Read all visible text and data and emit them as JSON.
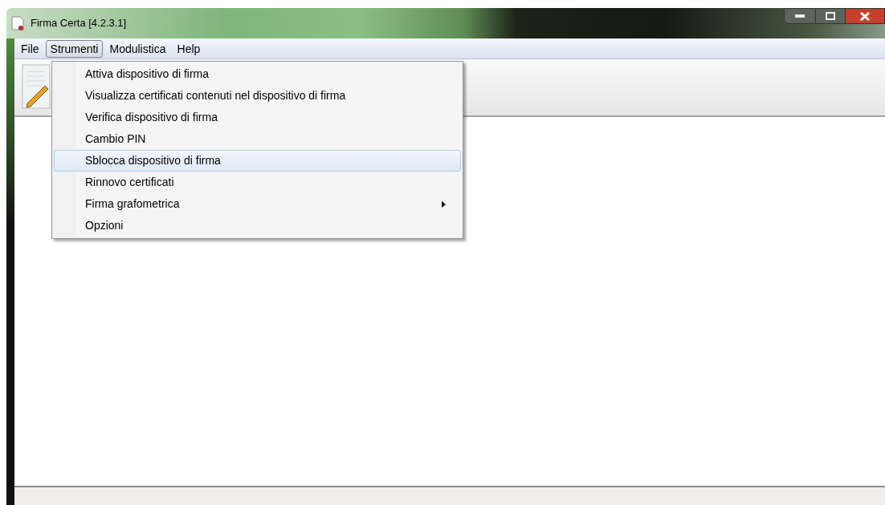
{
  "window": {
    "title": "Firma Certa [4.2.3.1]"
  },
  "menu_bar": [
    {
      "label": "File",
      "selected": false
    },
    {
      "label": "Strumenti",
      "selected": true
    },
    {
      "label": "Modulistica",
      "selected": false
    },
    {
      "label": "Help",
      "selected": false
    }
  ],
  "dropdown": {
    "items": [
      {
        "label": "Attiva dispositivo di firma",
        "selected": false,
        "kind": "plain"
      },
      {
        "label": "Visualizza certificati contenuti nel dispositivo di firma",
        "selected": false,
        "kind": "plain"
      },
      {
        "label": "Verifica dispositivo di firma",
        "selected": false,
        "kind": "plain"
      },
      {
        "label": "Cambio PIN",
        "selected": false,
        "kind": "plain"
      },
      {
        "label": "Sblocca dispositivo di firma",
        "selected": true,
        "kind": "plain"
      },
      {
        "label": "Rinnovo certificati",
        "selected": false,
        "kind": "plain"
      },
      {
        "label": "Firma grafometrica",
        "selected": false,
        "kind": "submenu"
      },
      {
        "label": "Opzioni",
        "selected": false,
        "kind": "plain"
      }
    ]
  }
}
